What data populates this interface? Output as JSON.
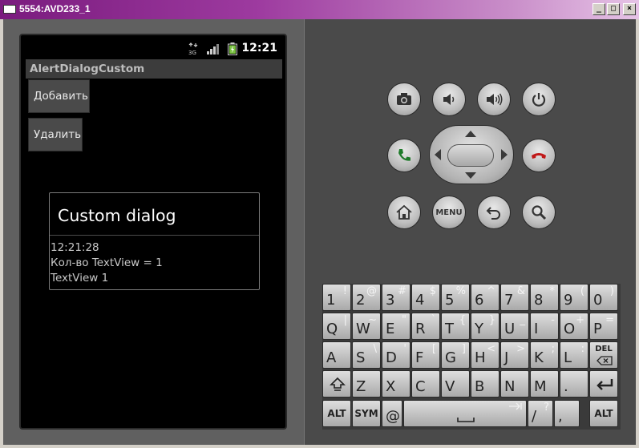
{
  "window": {
    "title": "5554:AVD233_1",
    "min": "_",
    "max": "□",
    "close": "×"
  },
  "status": {
    "time": "12:21",
    "net_label": "3G"
  },
  "app": {
    "title": "AlertDialogCustom",
    "add_button": "Добавить",
    "delete_button": "Удалить"
  },
  "dialog": {
    "title": "Custom dialog",
    "line1": "12:21:28",
    "line2": "Кол-во TextView = 1",
    "line3": "TextView 1"
  },
  "controls": {
    "menu_label": "MENU"
  },
  "keyboard": {
    "row1": [
      {
        "m": "1",
        "a": "!"
      },
      {
        "m": "2",
        "a": "@"
      },
      {
        "m": "3",
        "a": "#"
      },
      {
        "m": "4",
        "a": "$"
      },
      {
        "m": "5",
        "a": "%"
      },
      {
        "m": "6",
        "a": "^"
      },
      {
        "m": "7",
        "a": "&"
      },
      {
        "m": "8",
        "a": "*"
      },
      {
        "m": "9",
        "a": "("
      },
      {
        "m": "0",
        "a": ")"
      }
    ],
    "row2": [
      {
        "m": "Q",
        "a": "|"
      },
      {
        "m": "W",
        "a": "~"
      },
      {
        "m": "E",
        "a": "\""
      },
      {
        "m": "R",
        "a": "`"
      },
      {
        "m": "T",
        "a": "{"
      },
      {
        "m": "Y",
        "a": "}"
      },
      {
        "m": "U",
        "a": "_"
      },
      {
        "m": "I",
        "a": "-"
      },
      {
        "m": "O",
        "a": "+"
      },
      {
        "m": "P",
        "a": "="
      }
    ],
    "row3": [
      {
        "m": "A",
        "a": ""
      },
      {
        "m": "S",
        "a": "\\"
      },
      {
        "m": "D",
        "a": "'"
      },
      {
        "m": "F",
        "a": "["
      },
      {
        "m": "G",
        "a": "]"
      },
      {
        "m": "H",
        "a": "<"
      },
      {
        "m": "J",
        "a": ">"
      },
      {
        "m": "K",
        "a": ";"
      },
      {
        "m": "L",
        "a": ":"
      }
    ],
    "del_label": "DEL",
    "row4": [
      {
        "m": "Z",
        "a": ""
      },
      {
        "m": "X",
        "a": ""
      },
      {
        "m": "C",
        "a": ""
      },
      {
        "m": "V",
        "a": ""
      },
      {
        "m": "B",
        "a": ""
      },
      {
        "m": "N",
        "a": ""
      },
      {
        "m": "M",
        "a": ""
      },
      {
        "m": ".",
        "a": ""
      }
    ],
    "alt_label": "ALT",
    "sym_label": "SYM",
    "at_label": "@",
    "slash": {
      "m": "/",
      "a": "?"
    },
    "comma": ","
  }
}
